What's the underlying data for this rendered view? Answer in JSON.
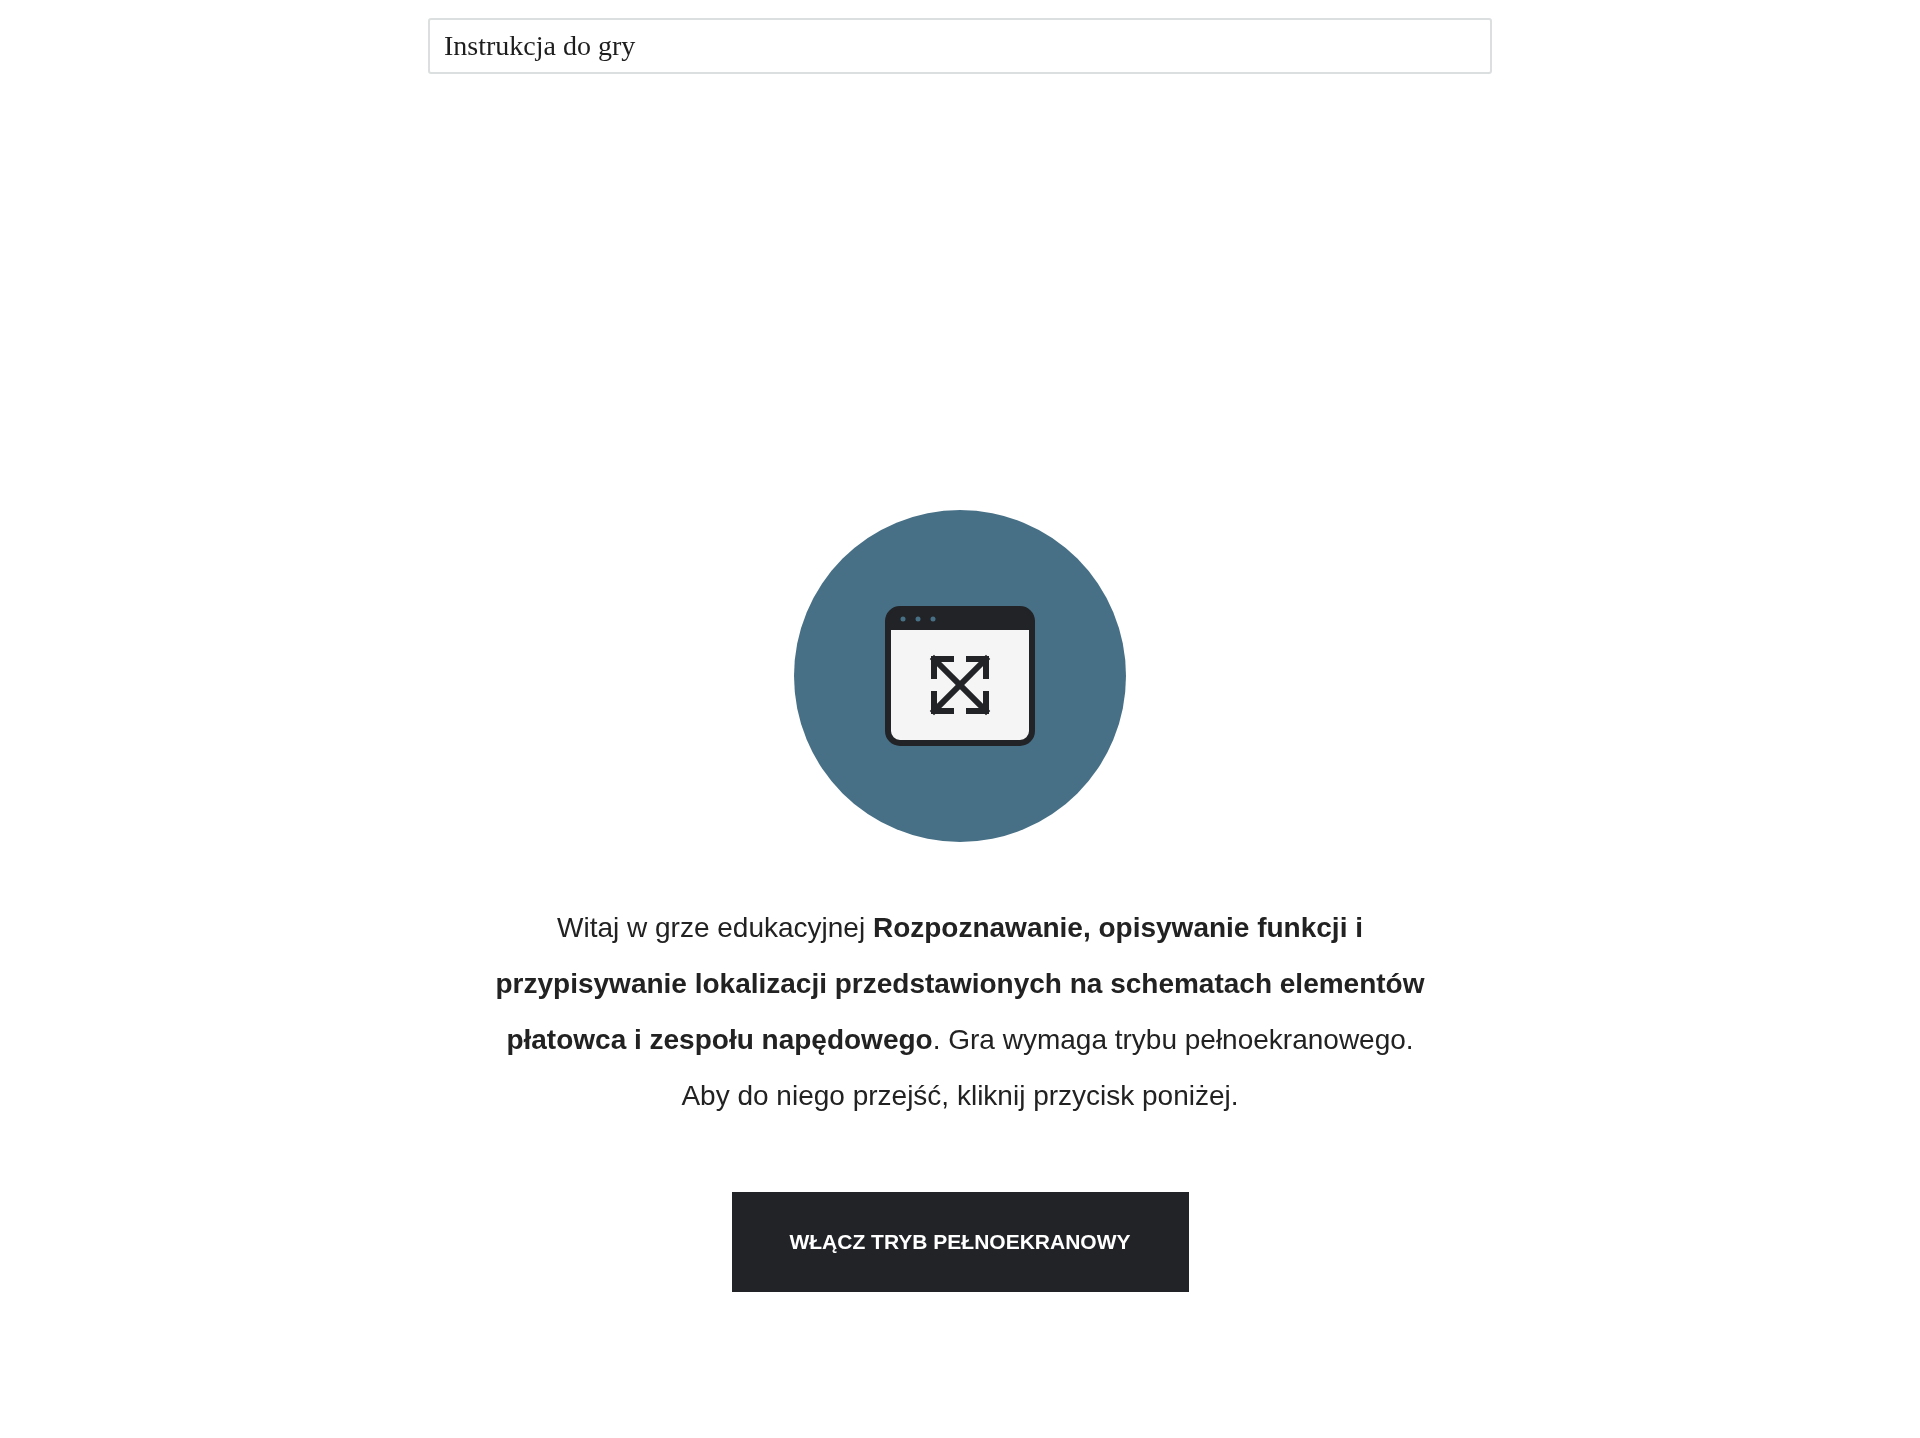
{
  "instructions_header": {
    "label": "Instrukcja do gry"
  },
  "intro": {
    "text": "Witaj w grze edukacyjnej **Rozpoznawanie, opisywanie funkcji i przypisywanie lokalizacji przedstawionych na schematach elementów płatowca i zespołu napędowego**. Gra wymaga trybu pełnoekranowego. Aby do niego przejść, kliknij przycisk poniżej."
  },
  "button": {
    "label": "WŁĄCZ TRYB PEŁNOEKRANOWY"
  }
}
